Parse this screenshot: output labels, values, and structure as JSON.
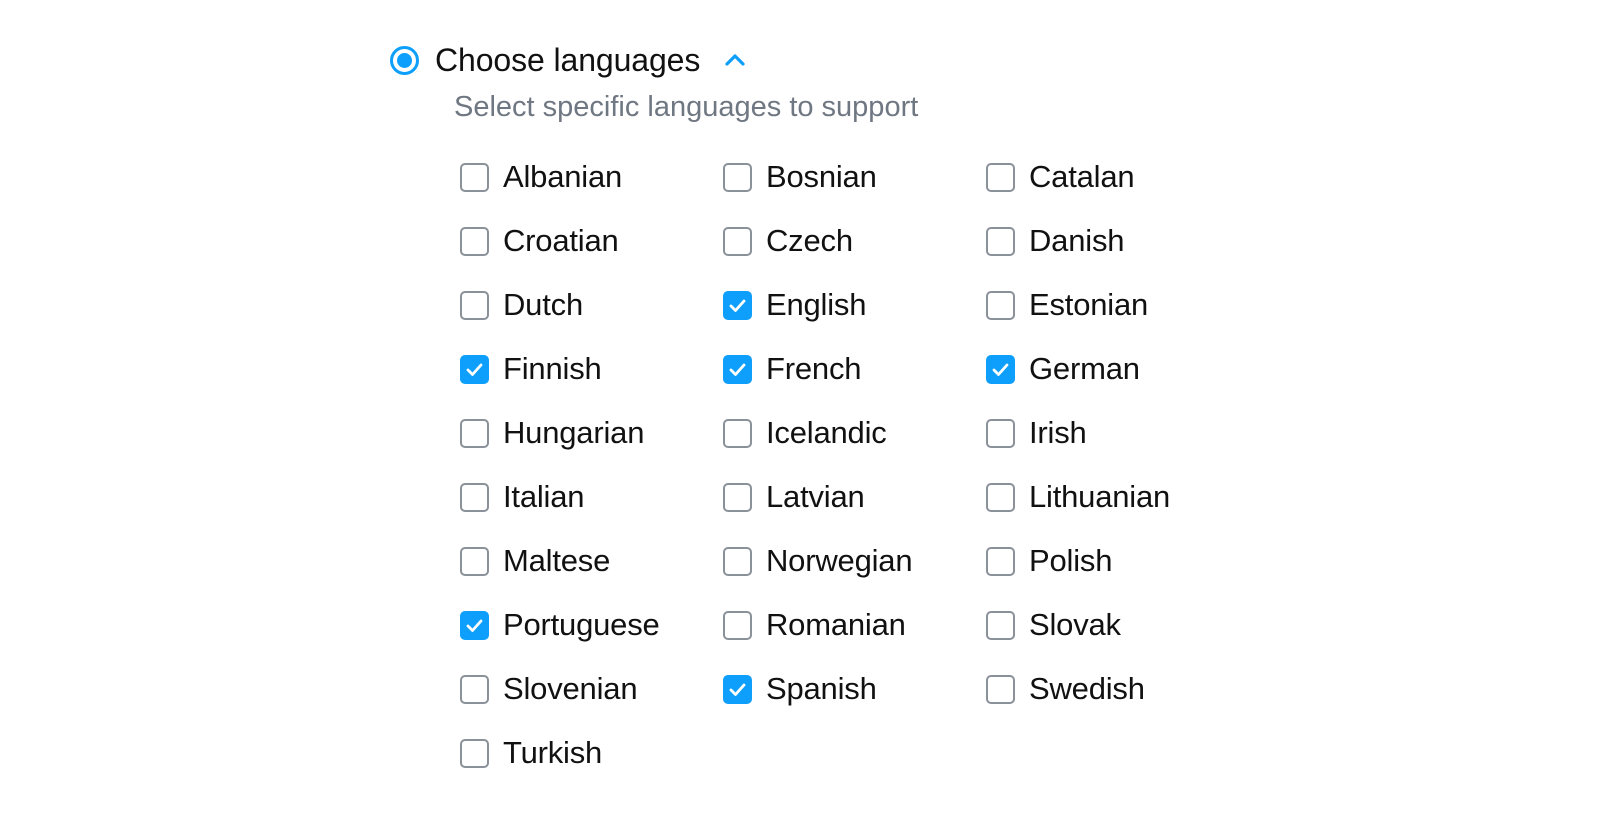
{
  "option": {
    "radio_selected": true,
    "title": "Choose languages",
    "subtitle": "Select specific languages to support",
    "collapse_icon": "chevron-up-icon",
    "expanded": true
  },
  "colors": {
    "accent": "#0d9ffb",
    "label_text": "#111111",
    "subtitle_text": "#6f7782",
    "checkbox_border": "#8a9199",
    "background": "#ffffff"
  },
  "languages": [
    {
      "label": "Albanian",
      "checked": false
    },
    {
      "label": "Bosnian",
      "checked": false
    },
    {
      "label": "Catalan",
      "checked": false
    },
    {
      "label": "Croatian",
      "checked": false
    },
    {
      "label": "Czech",
      "checked": false
    },
    {
      "label": "Danish",
      "checked": false
    },
    {
      "label": "Dutch",
      "checked": false
    },
    {
      "label": "English",
      "checked": true
    },
    {
      "label": "Estonian",
      "checked": false
    },
    {
      "label": "Finnish",
      "checked": true
    },
    {
      "label": "French",
      "checked": true
    },
    {
      "label": "German",
      "checked": true
    },
    {
      "label": "Hungarian",
      "checked": false
    },
    {
      "label": "Icelandic",
      "checked": false
    },
    {
      "label": "Irish",
      "checked": false
    },
    {
      "label": "Italian",
      "checked": false
    },
    {
      "label": "Latvian",
      "checked": false
    },
    {
      "label": "Lithuanian",
      "checked": false
    },
    {
      "label": "Maltese",
      "checked": false
    },
    {
      "label": "Norwegian",
      "checked": false
    },
    {
      "label": "Polish",
      "checked": false
    },
    {
      "label": "Portuguese",
      "checked": true
    },
    {
      "label": "Romanian",
      "checked": false
    },
    {
      "label": "Slovak",
      "checked": false
    },
    {
      "label": "Slovenian",
      "checked": false
    },
    {
      "label": "Spanish",
      "checked": true
    },
    {
      "label": "Swedish",
      "checked": false
    },
    {
      "label": "Turkish",
      "checked": false
    }
  ]
}
